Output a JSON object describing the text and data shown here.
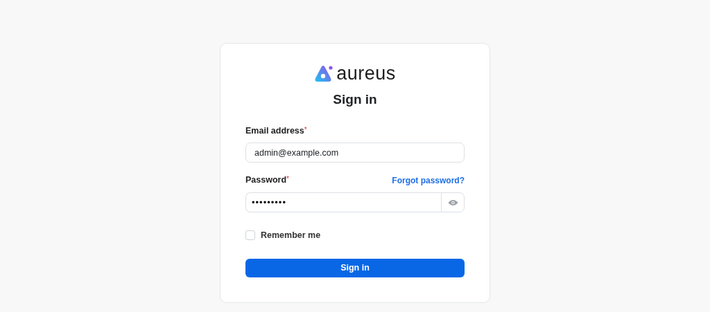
{
  "logo": {
    "text": "aureus"
  },
  "title": "Sign in",
  "fields": [
    {
      "kind": "email",
      "label": "Email address",
      "required_mark": "*",
      "value": "admin@example.com"
    },
    {
      "kind": "password",
      "label": "Password",
      "required_mark": "*",
      "value": "•••••••••",
      "link": "Forgot password?"
    }
  ],
  "remember": {
    "label": "Remember me",
    "checked": false
  },
  "submit": "Sign in"
}
